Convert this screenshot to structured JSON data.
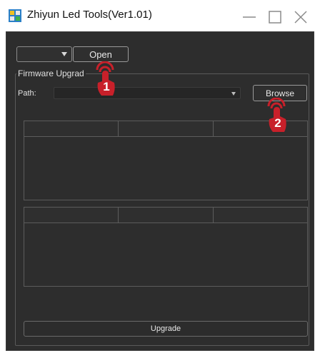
{
  "window": {
    "title": "Zhiyun Led Tools(Ver1.01)",
    "app_icon": "app-icon",
    "controls": [
      "minimize-icon",
      "maximize-icon",
      "close-icon"
    ]
  },
  "toolbar": {
    "device_select_value": "",
    "open_label": "Open"
  },
  "firmware": {
    "group_title": "Firmware Upgrad",
    "path_label": "Path:",
    "path_value": "",
    "browse_label": "Browse",
    "upgrade_label": "Upgrade",
    "table1_headers": [
      "",
      "",
      ""
    ],
    "table2_headers": [
      "",
      "",
      ""
    ]
  },
  "annotations": [
    {
      "label": "1",
      "icon": "tap-hand-icon"
    },
    {
      "label": "2",
      "icon": "tap-hand-icon"
    }
  ],
  "colors": {
    "panel_bg": "#2d2d2d",
    "marker_red": "#c8202a",
    "text_light": "#e0e0e0"
  }
}
